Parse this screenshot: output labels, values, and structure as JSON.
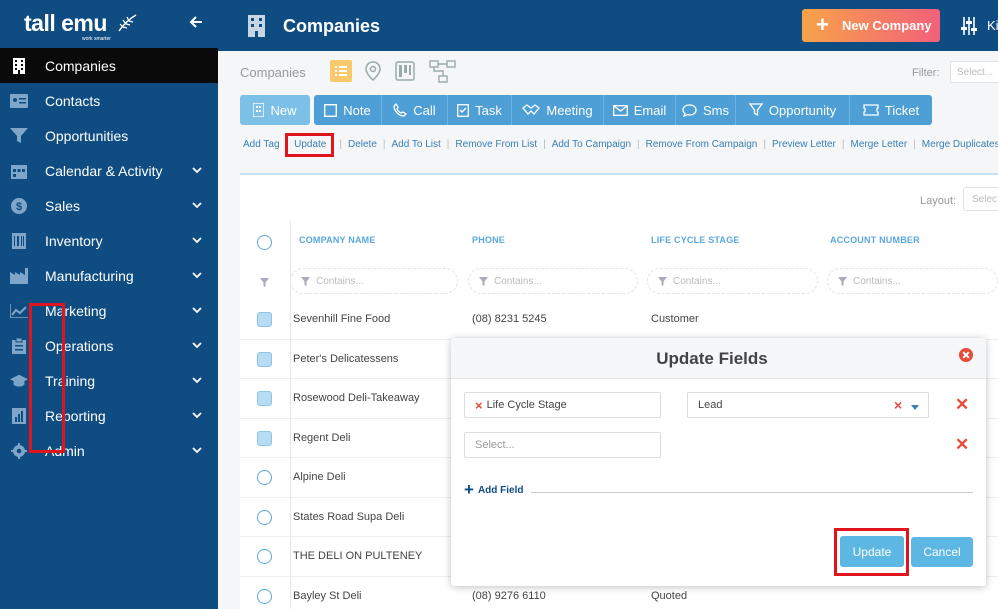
{
  "app": {
    "logo": "tall emu",
    "logo_tagline": "work smarter"
  },
  "colors": {
    "sidebar": "#0f4c81",
    "accent": "#4d9fd6",
    "highlight": "#e0141c"
  },
  "sidebar": {
    "items": [
      {
        "label": "Companies",
        "icon": "building-icon"
      },
      {
        "label": "Contacts",
        "icon": "id-card-icon"
      },
      {
        "label": "Opportunities",
        "icon": "funnel-icon"
      },
      {
        "label": "Calendar & Activity",
        "icon": "calendar-icon"
      },
      {
        "label": "Sales",
        "icon": "dollar-icon"
      },
      {
        "label": "Inventory",
        "icon": "barcode-icon"
      },
      {
        "label": "Manufacturing",
        "icon": "factory-icon"
      },
      {
        "label": "Marketing",
        "icon": "chart-line-icon"
      },
      {
        "label": "Operations",
        "icon": "clipboard-icon"
      },
      {
        "label": "Training",
        "icon": "graduation-cap-icon"
      },
      {
        "label": "Reporting",
        "icon": "report-icon"
      },
      {
        "label": "Admin",
        "icon": "gear-icon"
      }
    ]
  },
  "header": {
    "title": "Companies",
    "new_button": "New Company",
    "user_initial": "Ki"
  },
  "toolbar": {
    "breadcrumb": "Companies",
    "filter_label": "Filter:",
    "filter_placeholder": "Select...",
    "actions": [
      "New",
      "Note",
      "Call",
      "Task",
      "Meeting",
      "Email",
      "Sms",
      "Opportunity",
      "Ticket"
    ],
    "links": [
      "Add Tag",
      "Update",
      "Delete",
      "Add To List",
      "Remove From List",
      "Add To Campaign",
      "Remove From Campaign",
      "Preview Letter",
      "Merge Letter",
      "Merge Duplicates"
    ]
  },
  "table": {
    "layout_label": "Layout:",
    "layout_placeholder": "Selec",
    "filter_placeholder": "Contains...",
    "columns": [
      "COMPANY NAME",
      "PHONE",
      "LIFE CYCLE STAGE",
      "ACCOUNT NUMBER"
    ],
    "rows": [
      {
        "name": "Sevenhill Fine Food",
        "phone": "(08) 8231 5245",
        "stage": "Customer",
        "checked": true
      },
      {
        "name": "Peter's Delicatessens",
        "phone": "",
        "stage": "",
        "checked": true
      },
      {
        "name": "Rosewood Deli-Takeaway",
        "phone": "",
        "stage": "",
        "checked": true
      },
      {
        "name": "Regent Deli",
        "phone": "",
        "stage": "",
        "checked": true
      },
      {
        "name": "Alpine Deli",
        "phone": "",
        "stage": "",
        "checked": false
      },
      {
        "name": "States Road Supa Deli",
        "phone": "",
        "stage": "",
        "checked": false
      },
      {
        "name": "THE DELI ON PULTENEY",
        "phone": "",
        "stage": "",
        "checked": false
      },
      {
        "name": "Bayley St Deli",
        "phone": "(08) 9276 6110",
        "stage": "Quoted",
        "checked": false
      }
    ]
  },
  "modal": {
    "title": "Update Fields",
    "field1": "Life Cycle Stage",
    "value1": "Lead",
    "field2_placeholder": "Select...",
    "add_field": "Add Field",
    "update_button": "Update",
    "cancel_button": "Cancel"
  }
}
